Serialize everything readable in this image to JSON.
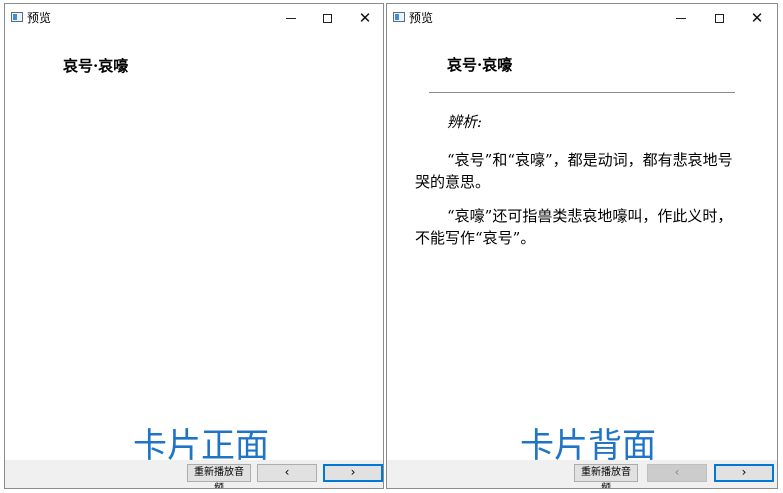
{
  "front_window": {
    "title": "预览",
    "controls": {
      "minimize": "",
      "maximize": "",
      "close": "✕"
    },
    "card_title": "哀号·哀嚎",
    "buttons": {
      "replay": "重新播放音频",
      "prev": "‹",
      "next": "›"
    }
  },
  "back_window": {
    "title": "预览",
    "controls": {
      "minimize": "",
      "maximize": "",
      "close": "✕"
    },
    "card_title": "哀号·哀嚎",
    "analysis_label": "辨析:",
    "paragraphs": [
      "“哀号”和“哀嚎”，都是动词，都有悲哀地号哭的意思。",
      "“哀嚎”还可指兽类悲哀地嚎叫，作此义时，不能写作“哀号”。"
    ],
    "buttons": {
      "replay": "重新播放音频",
      "prev": "‹",
      "next": "›"
    }
  },
  "captions": {
    "front": "卡片正面",
    "back": "卡片背面"
  },
  "colors": {
    "caption": "#1f74c8",
    "focus_border": "#0078d7"
  }
}
